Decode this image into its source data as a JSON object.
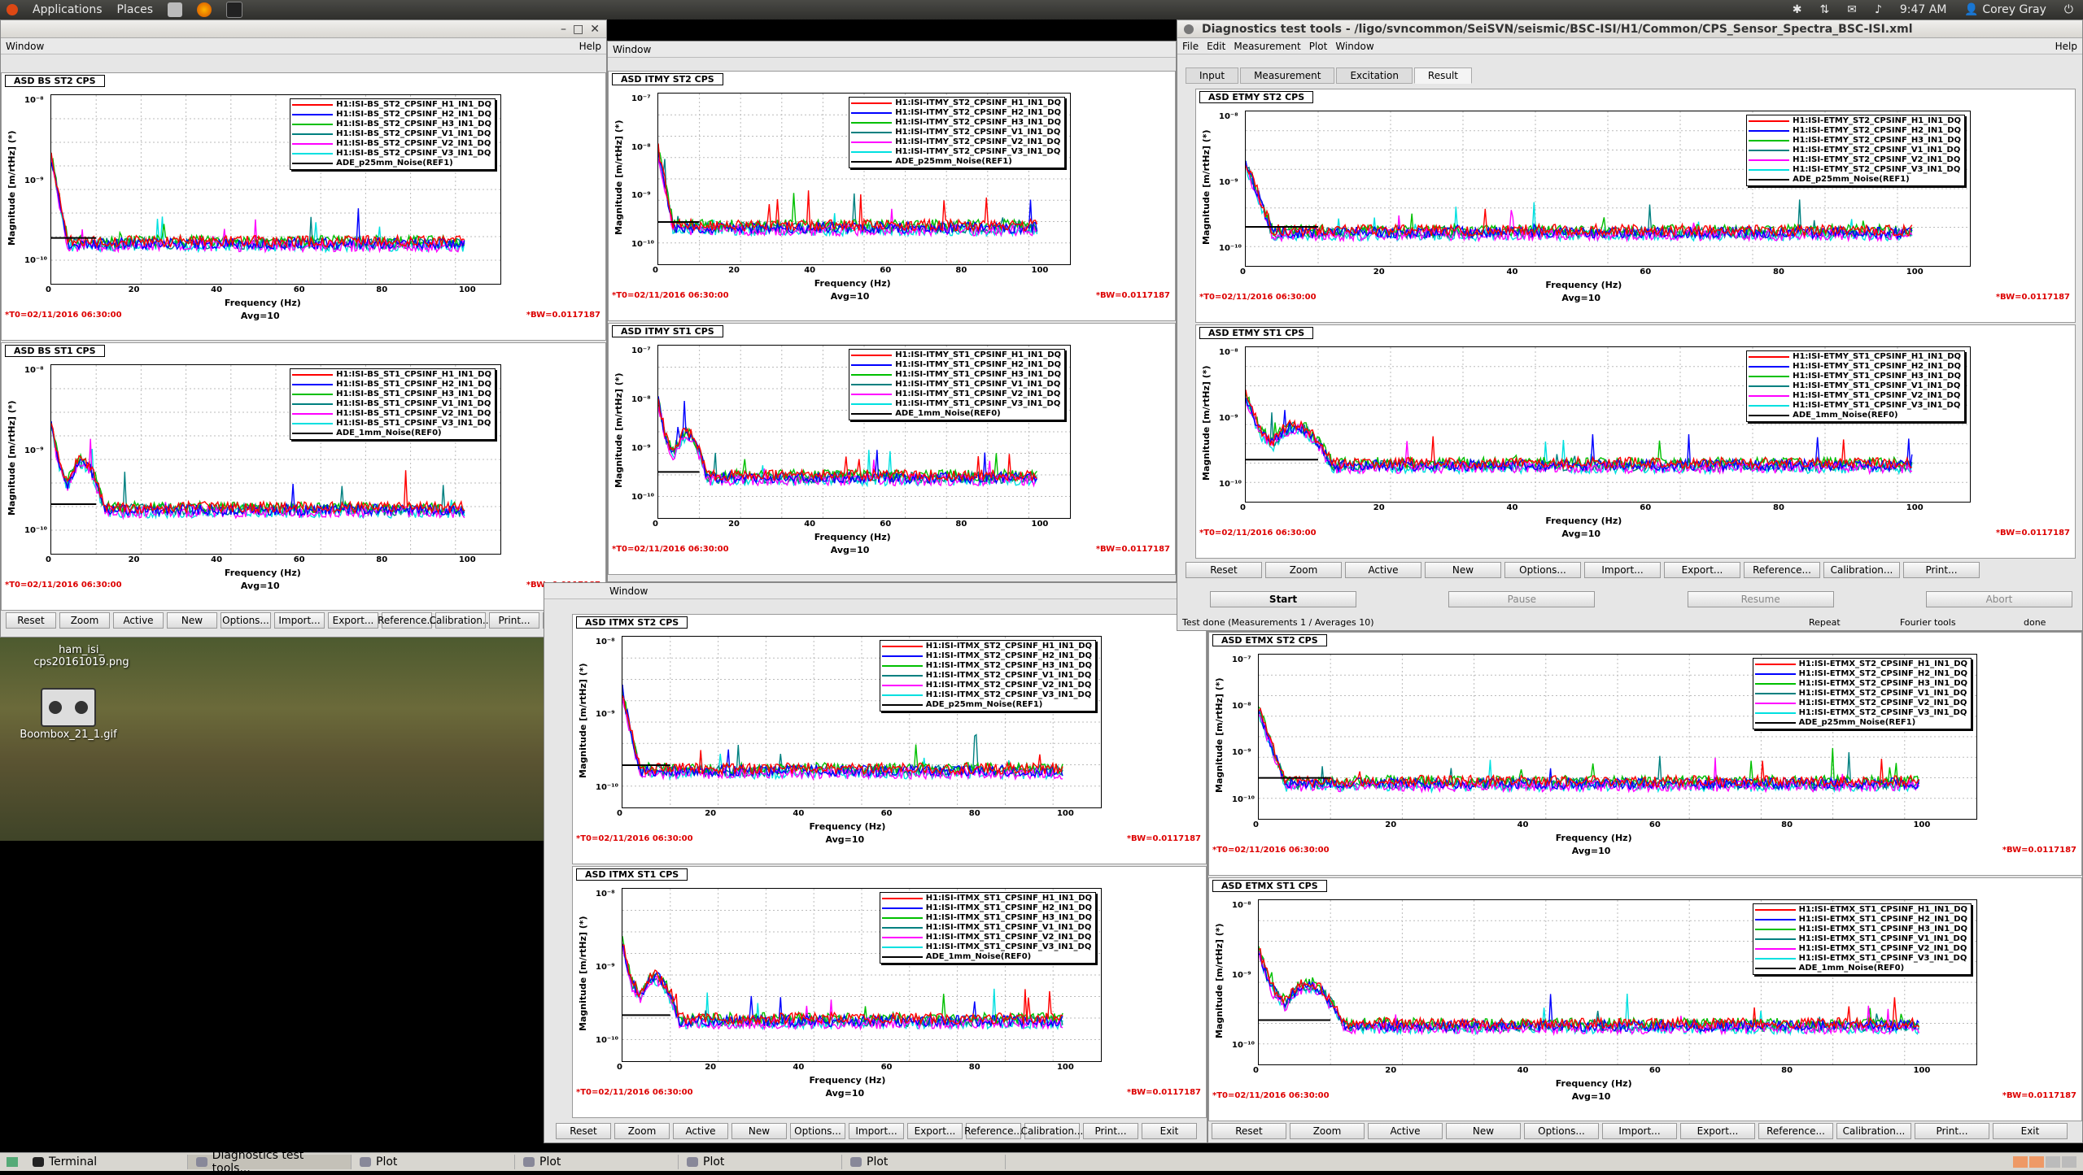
{
  "topbar": {
    "apps": "Applications",
    "places": "Places",
    "time": "9:47 AM",
    "user": "Corey Gray"
  },
  "desktop": {
    "icons": [
      {
        "label": "ham_isi_\ncps20161019.png"
      },
      {
        "label": "Boombox_21_1.gif"
      }
    ]
  },
  "taskbar": {
    "items": [
      {
        "label": "Terminal"
      },
      {
        "label": "Diagnostics test tools..."
      },
      {
        "label": "Plot"
      },
      {
        "label": "Plot"
      },
      {
        "label": "Plot"
      },
      {
        "label": "Plot"
      }
    ]
  },
  "menus": {
    "window": "Window",
    "help": "Help"
  },
  "main_window": {
    "title": "Diagnostics test tools - /ligo/svncommon/SeiSVN/seismic/BSC-ISI/H1/Common/CPS_Sensor_Spectra_BSC-ISI.xml",
    "menu": [
      "File",
      "Edit",
      "Measurement",
      "Plot",
      "Window"
    ],
    "help": "Help",
    "tabs": [
      "Input",
      "Measurement",
      "Excitation",
      "Result"
    ],
    "controls": [
      "Start",
      "Pause",
      "Resume",
      "Abort"
    ],
    "status_left": "Test done (Measurements 1 / Averages 10)",
    "status_repeat": "Repeat",
    "status_fourier": "Fourier tools",
    "status_done": "done"
  },
  "buttons": [
    "Reset",
    "Zoom",
    "Active",
    "New",
    "Options...",
    "Import...",
    "Export...",
    "Reference...",
    "Calibration...",
    "Print...",
    "Exit"
  ],
  "common": {
    "xlabel": "Frequency (Hz)",
    "ylabel": "Magnitude [m/rtHz] (*)",
    "avg": "Avg=10",
    "t0": "*T0=02/11/2016 06:30:00",
    "bw": "*BW=0.0117187"
  },
  "colors": {
    "H1": "#ff0000",
    "H2": "#0000ff",
    "H3": "#00c000",
    "V1": "#008080",
    "V2": "#ff00ff",
    "V3": "#00e0e0",
    "REF": "#000000"
  },
  "panels": [
    {
      "id": "bs_st2",
      "title": "ASD BS ST2 CPS",
      "legend": [
        "H1:ISI-BS_ST2_CPSINF_H1_IN1_DQ",
        "H1:ISI-BS_ST2_CPSINF_H2_IN1_DQ",
        "H1:ISI-BS_ST2_CPSINF_H3_IN1_DQ",
        "H1:ISI-BS_ST2_CPSINF_V1_IN1_DQ",
        "H1:ISI-BS_ST2_CPSINF_V2_IN1_DQ",
        "H1:ISI-BS_ST2_CPSINF_V3_IN1_DQ",
        "ADE_p25mm_Noise(REF1)"
      ],
      "yticks": [
        "10⁻⁸",
        "10⁻⁹",
        "10⁻¹⁰"
      ]
    },
    {
      "id": "bs_st1",
      "title": "ASD BS ST1 CPS",
      "legend": [
        "H1:ISI-BS_ST1_CPSINF_H1_IN1_DQ",
        "H1:ISI-BS_ST1_CPSINF_H2_IN1_DQ",
        "H1:ISI-BS_ST1_CPSINF_H3_IN1_DQ",
        "H1:ISI-BS_ST1_CPSINF_V1_IN1_DQ",
        "H1:ISI-BS_ST1_CPSINF_V2_IN1_DQ",
        "H1:ISI-BS_ST1_CPSINF_V3_IN1_DQ",
        "ADE_1mm_Noise(REF0)"
      ],
      "yticks": [
        "10⁻⁸",
        "10⁻⁹",
        "10⁻¹⁰"
      ]
    },
    {
      "id": "itmy_st2",
      "title": "ASD ITMY ST2 CPS",
      "legend": [
        "H1:ISI-ITMY_ST2_CPSINF_H1_IN1_DQ",
        "H1:ISI-ITMY_ST2_CPSINF_H2_IN1_DQ",
        "H1:ISI-ITMY_ST2_CPSINF_H3_IN1_DQ",
        "H1:ISI-ITMY_ST2_CPSINF_V1_IN1_DQ",
        "H1:ISI-ITMY_ST2_CPSINF_V2_IN1_DQ",
        "H1:ISI-ITMY_ST2_CPSINF_V3_IN1_DQ",
        "ADE_p25mm_Noise(REF1)"
      ],
      "yticks": [
        "10⁻⁷",
        "10⁻⁸",
        "10⁻⁹",
        "10⁻¹⁰"
      ]
    },
    {
      "id": "itmy_st1",
      "title": "ASD ITMY ST1 CPS",
      "legend": [
        "H1:ISI-ITMY_ST1_CPSINF_H1_IN1_DQ",
        "H1:ISI-ITMY_ST1_CPSINF_H2_IN1_DQ",
        "H1:ISI-ITMY_ST1_CPSINF_H3_IN1_DQ",
        "H1:ISI-ITMY_ST1_CPSINF_V1_IN1_DQ",
        "H1:ISI-ITMY_ST1_CPSINF_V2_IN1_DQ",
        "H1:ISI-ITMY_ST1_CPSINF_V3_IN1_DQ",
        "ADE_1mm_Noise(REF0)"
      ],
      "yticks": [
        "10⁻⁷",
        "10⁻⁸",
        "10⁻⁹",
        "10⁻¹⁰"
      ]
    },
    {
      "id": "itmx_st2",
      "title": "ASD ITMX ST2 CPS",
      "legend": [
        "H1:ISI-ITMX_ST2_CPSINF_H1_IN1_DQ",
        "H1:ISI-ITMX_ST2_CPSINF_H2_IN1_DQ",
        "H1:ISI-ITMX_ST2_CPSINF_H3_IN1_DQ",
        "H1:ISI-ITMX_ST2_CPSINF_V1_IN1_DQ",
        "H1:ISI-ITMX_ST2_CPSINF_V2_IN1_DQ",
        "H1:ISI-ITMX_ST2_CPSINF_V3_IN1_DQ",
        "ADE_p25mm_Noise(REF1)"
      ],
      "yticks": [
        "10⁻⁸",
        "10⁻⁹",
        "10⁻¹⁰"
      ]
    },
    {
      "id": "itmx_st1",
      "title": "ASD ITMX ST1 CPS",
      "legend": [
        "H1:ISI-ITMX_ST1_CPSINF_H1_IN1_DQ",
        "H1:ISI-ITMX_ST1_CPSINF_H2_IN1_DQ",
        "H1:ISI-ITMX_ST1_CPSINF_H3_IN1_DQ",
        "H1:ISI-ITMX_ST1_CPSINF_V1_IN1_DQ",
        "H1:ISI-ITMX_ST1_CPSINF_V2_IN1_DQ",
        "H1:ISI-ITMX_ST1_CPSINF_V3_IN1_DQ",
        "ADE_1mm_Noise(REF0)"
      ],
      "yticks": [
        "10⁻⁸",
        "10⁻⁹",
        "10⁻¹⁰"
      ]
    },
    {
      "id": "etmy_st2",
      "title": "ASD ETMY ST2 CPS",
      "legend": [
        "H1:ISI-ETMY_ST2_CPSINF_H1_IN1_DQ",
        "H1:ISI-ETMY_ST2_CPSINF_H2_IN1_DQ",
        "H1:ISI-ETMY_ST2_CPSINF_H3_IN1_DQ",
        "H1:ISI-ETMY_ST2_CPSINF_V1_IN1_DQ",
        "H1:ISI-ETMY_ST2_CPSINF_V2_IN1_DQ",
        "H1:ISI-ETMY_ST2_CPSINF_V3_IN1_DQ",
        "ADE_p25mm_Noise(REF1)"
      ],
      "yticks": [
        "10⁻⁸",
        "10⁻⁹",
        "10⁻¹⁰"
      ]
    },
    {
      "id": "etmy_st1",
      "title": "ASD ETMY ST1 CPS",
      "legend": [
        "H1:ISI-ETMY_ST1_CPSINF_H1_IN1_DQ",
        "H1:ISI-ETMY_ST1_CPSINF_H2_IN1_DQ",
        "H1:ISI-ETMY_ST1_CPSINF_H3_IN1_DQ",
        "H1:ISI-ETMY_ST1_CPSINF_V1_IN1_DQ",
        "H1:ISI-ETMY_ST1_CPSINF_V2_IN1_DQ",
        "H1:ISI-ETMY_ST1_CPSINF_V3_IN1_DQ",
        "ADE_1mm_Noise(REF0)"
      ],
      "yticks": [
        "10⁻⁸",
        "10⁻⁹",
        "10⁻¹⁰"
      ]
    },
    {
      "id": "etmx_st2",
      "title": "ASD ETMX ST2 CPS",
      "legend": [
        "H1:ISI-ETMX_ST2_CPSINF_H1_IN1_DQ",
        "H1:ISI-ETMX_ST2_CPSINF_H2_IN1_DQ",
        "H1:ISI-ETMX_ST2_CPSINF_H3_IN1_DQ",
        "H1:ISI-ETMX_ST2_CPSINF_V1_IN1_DQ",
        "H1:ISI-ETMX_ST2_CPSINF_V2_IN1_DQ",
        "H1:ISI-ETMX_ST2_CPSINF_V3_IN1_DQ",
        "ADE_p25mm_Noise(REF1)"
      ],
      "yticks": [
        "10⁻⁷",
        "10⁻⁸",
        "10⁻⁹",
        "10⁻¹⁰"
      ]
    },
    {
      "id": "etmx_st1",
      "title": "ASD ETMX ST1 CPS",
      "legend": [
        "H1:ISI-ETMX_ST1_CPSINF_H1_IN1_DQ",
        "H1:ISI-ETMX_ST1_CPSINF_H2_IN1_DQ",
        "H1:ISI-ETMX_ST1_CPSINF_H3_IN1_DQ",
        "H1:ISI-ETMX_ST1_CPSINF_V1_IN1_DQ",
        "H1:ISI-ETMX_ST1_CPSINF_V2_IN1_DQ",
        "H1:ISI-ETMX_ST1_CPSINF_V3_IN1_DQ",
        "ADE_1mm_Noise(REF0)"
      ],
      "yticks": [
        "10⁻⁸",
        "10⁻⁹",
        "10⁻¹⁰"
      ]
    }
  ],
  "xticks": [
    "0",
    "20",
    "40",
    "60",
    "80",
    "100"
  ]
}
